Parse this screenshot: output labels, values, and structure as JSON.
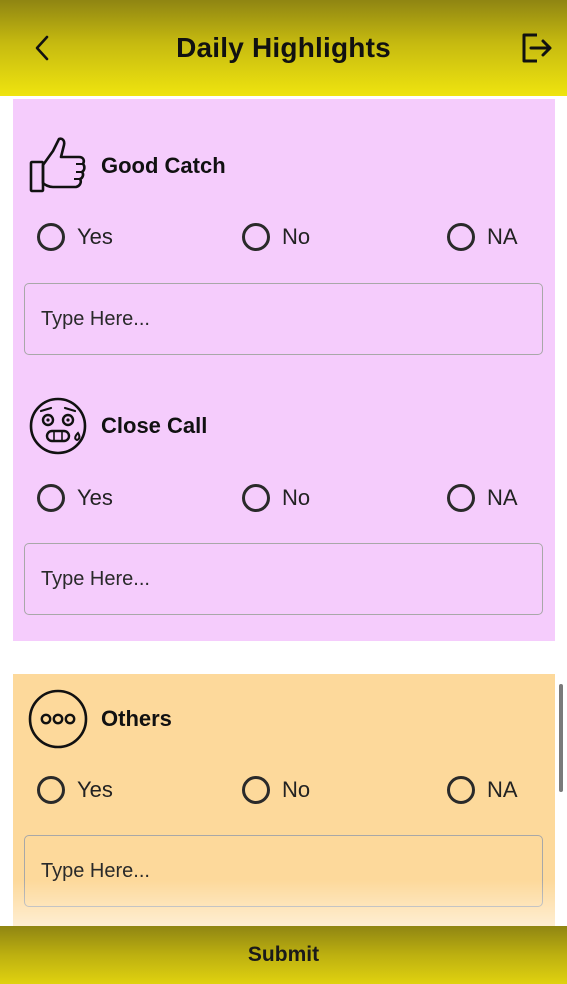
{
  "header": {
    "title": "Daily Highlights",
    "back_icon": "chevron-left-icon",
    "logout_icon": "logout-icon"
  },
  "colors": {
    "header_yellow": "#efe40f",
    "pink_section": "#f5ccfc",
    "orange_section": "#fdd99b"
  },
  "sections": [
    {
      "name": "good-catch",
      "icon": "thumbs-up-icon",
      "label": "Good Catch",
      "options": [
        "Yes",
        "No",
        "NA"
      ],
      "selected": null,
      "placeholder": "Type Here..."
    },
    {
      "name": "close-call",
      "icon": "anxious-face-icon",
      "label": "Close Call",
      "options": [
        "Yes",
        "No",
        "NA"
      ],
      "selected": null,
      "placeholder": "Type Here..."
    },
    {
      "name": "others",
      "icon": "more-dots-icon",
      "label": "Others",
      "options": [
        "Yes",
        "No",
        "NA"
      ],
      "selected": null,
      "placeholder": "Type Here..."
    }
  ],
  "footer": {
    "submit_label": "Submit"
  }
}
